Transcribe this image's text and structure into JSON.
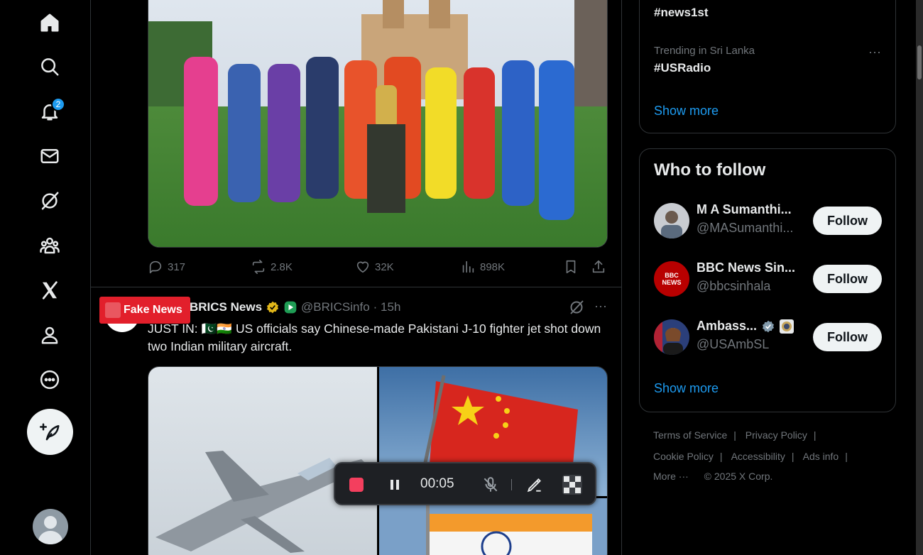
{
  "nav": {
    "items": [
      {
        "name": "home",
        "icon": "home-icon"
      },
      {
        "name": "explore",
        "icon": "search-icon"
      },
      {
        "name": "notifications",
        "icon": "bell-icon",
        "badge": "2"
      },
      {
        "name": "messages",
        "icon": "mail-icon"
      },
      {
        "name": "grok",
        "icon": "grok-icon"
      },
      {
        "name": "communities",
        "icon": "people-icon"
      },
      {
        "name": "premium",
        "icon": "x-logo-icon"
      },
      {
        "name": "profile",
        "icon": "person-icon"
      },
      {
        "name": "more",
        "icon": "more-circle-icon"
      }
    ],
    "post_icon": "feather-plus-icon"
  },
  "tweet1": {
    "replies": "317",
    "reposts": "2.8K",
    "likes": "32K",
    "views": "898K"
  },
  "tweet2": {
    "overlay_badge": "Fake News",
    "name": "BRICS News",
    "handle": "@BRICSinfo",
    "time": "· 15h",
    "text": "JUST IN: 🇵🇰🇮🇳 US officials say Chinese-made Pakistani J-10 fighter jet shot down two Indian military aircraft."
  },
  "recorder": {
    "time": "00:05"
  },
  "trends": [
    {
      "tag": "#news1st"
    },
    {
      "meta": "Trending in Sri Lanka",
      "tag": "#USRadio"
    }
  ],
  "trends_show_more": "Show more",
  "who_to_follow": {
    "title": "Who to follow",
    "users": [
      {
        "name": "M A Sumanthi...",
        "handle": "@MASumanthi...",
        "button": "Follow"
      },
      {
        "name": "BBC News Sin...",
        "handle": "@bbcsinhala",
        "button": "Follow",
        "avatar_text": "BBC NEWS"
      },
      {
        "name": "Ambass...",
        "handle": "@USAmbSL",
        "button": "Follow"
      }
    ],
    "show_more": "Show more"
  },
  "footer": {
    "terms": "Terms of Service",
    "privacy": "Privacy Policy",
    "cookie": "Cookie Policy",
    "accessibility": "Accessibility",
    "ads": "Ads info",
    "more": "More ···",
    "copyright": "© 2025 X Corp."
  },
  "colors": {
    "accent": "#1d9bf0",
    "background": "#000000",
    "record_stop": "#f43f5e",
    "fake_badge": "#e21f2b"
  }
}
